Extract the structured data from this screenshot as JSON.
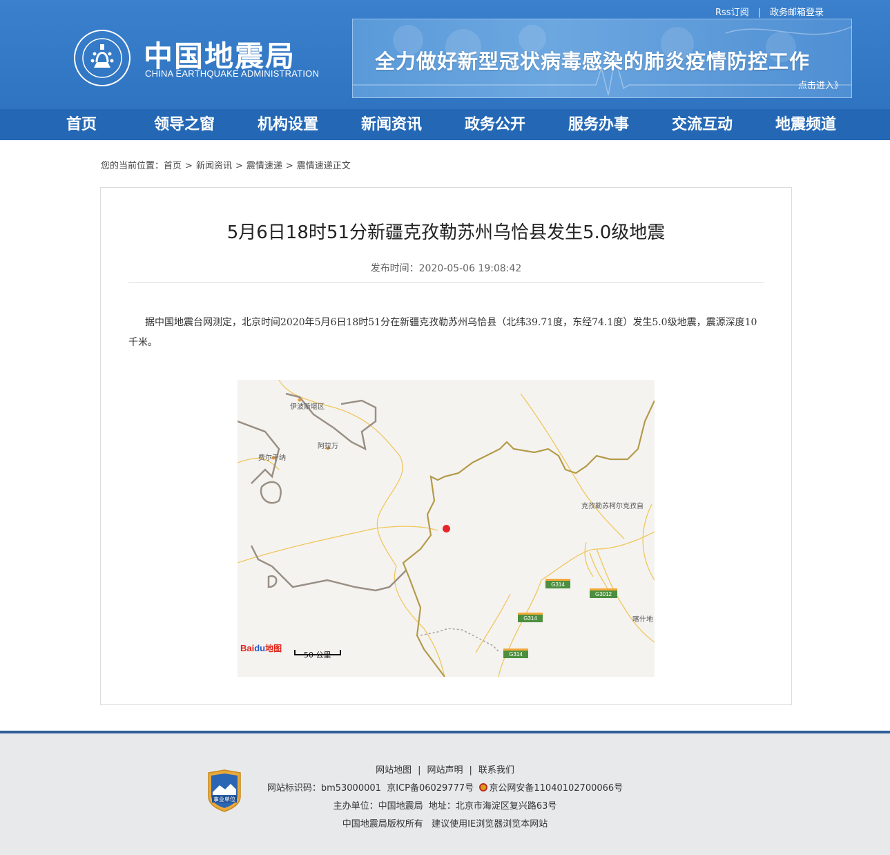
{
  "header": {
    "top_links": [
      "Rss订阅",
      "政务邮箱登录"
    ],
    "logo_cn": "中国地震局",
    "logo_en": "CHINA EARTHQUAKE ADMINISTRATION",
    "banner_title": "全力做好新型冠状病毒感染的肺炎疫情防控工作",
    "banner_link": "点击进入》"
  },
  "nav": {
    "items": [
      "首页",
      "领导之窗",
      "机构设置",
      "新闻资讯",
      "政务公开",
      "服务办事",
      "交流互动",
      "地震频道"
    ]
  },
  "breadcrumb": {
    "prefix": "您的当前位置：",
    "items": [
      "首页",
      "新闻资讯",
      "震情速递",
      "震情速递正文"
    ],
    "separator": ">"
  },
  "article": {
    "title": "5月6日18时51分新疆克孜勒苏州乌恰县发生5.0级地震",
    "pub_time": "发布时间：2020-05-06 19:08:42",
    "body": "据中国地震台网测定，北京时间2020年5月6日18时51分在新疆克孜勒苏州乌恰县（北纬39.71度，东经74.1度）发生5.0级地震，震源深度10千米。"
  },
  "map": {
    "labels": {
      "yibosi": "伊波斯堪区",
      "alawan": "阿拉万",
      "feierganna": "费尔干纳",
      "kezilesu": "克孜勒苏柯尔克孜自",
      "kashi": "喀什地"
    },
    "roads": [
      "G314",
      "G3012",
      "G314",
      "G314"
    ],
    "scale": "50 公里",
    "logo": {
      "ba": "Bai",
      "paw": "du",
      "tu": "地图"
    },
    "epicenter_color": "#e5262b"
  },
  "footer": {
    "links": [
      "网站地图",
      "网站声明",
      "联系我们"
    ],
    "site_id": "网站标识码：bm53000001",
    "icp": "京ICP备06029777号",
    "police": "京公网安备11040102700066号",
    "sponsor": "主办单位：中国地震局",
    "address": "地址：北京市海淀区复兴路63号",
    "copyright": "中国地震局版权所有",
    "browser_tip": "建议使用IE浏览器浏览本网站",
    "badge_text": "事业单位"
  },
  "colors": {
    "header_blue": "#3a80cc",
    "nav_blue": "#2468b5",
    "footer_bg": "#e8e9eb"
  }
}
